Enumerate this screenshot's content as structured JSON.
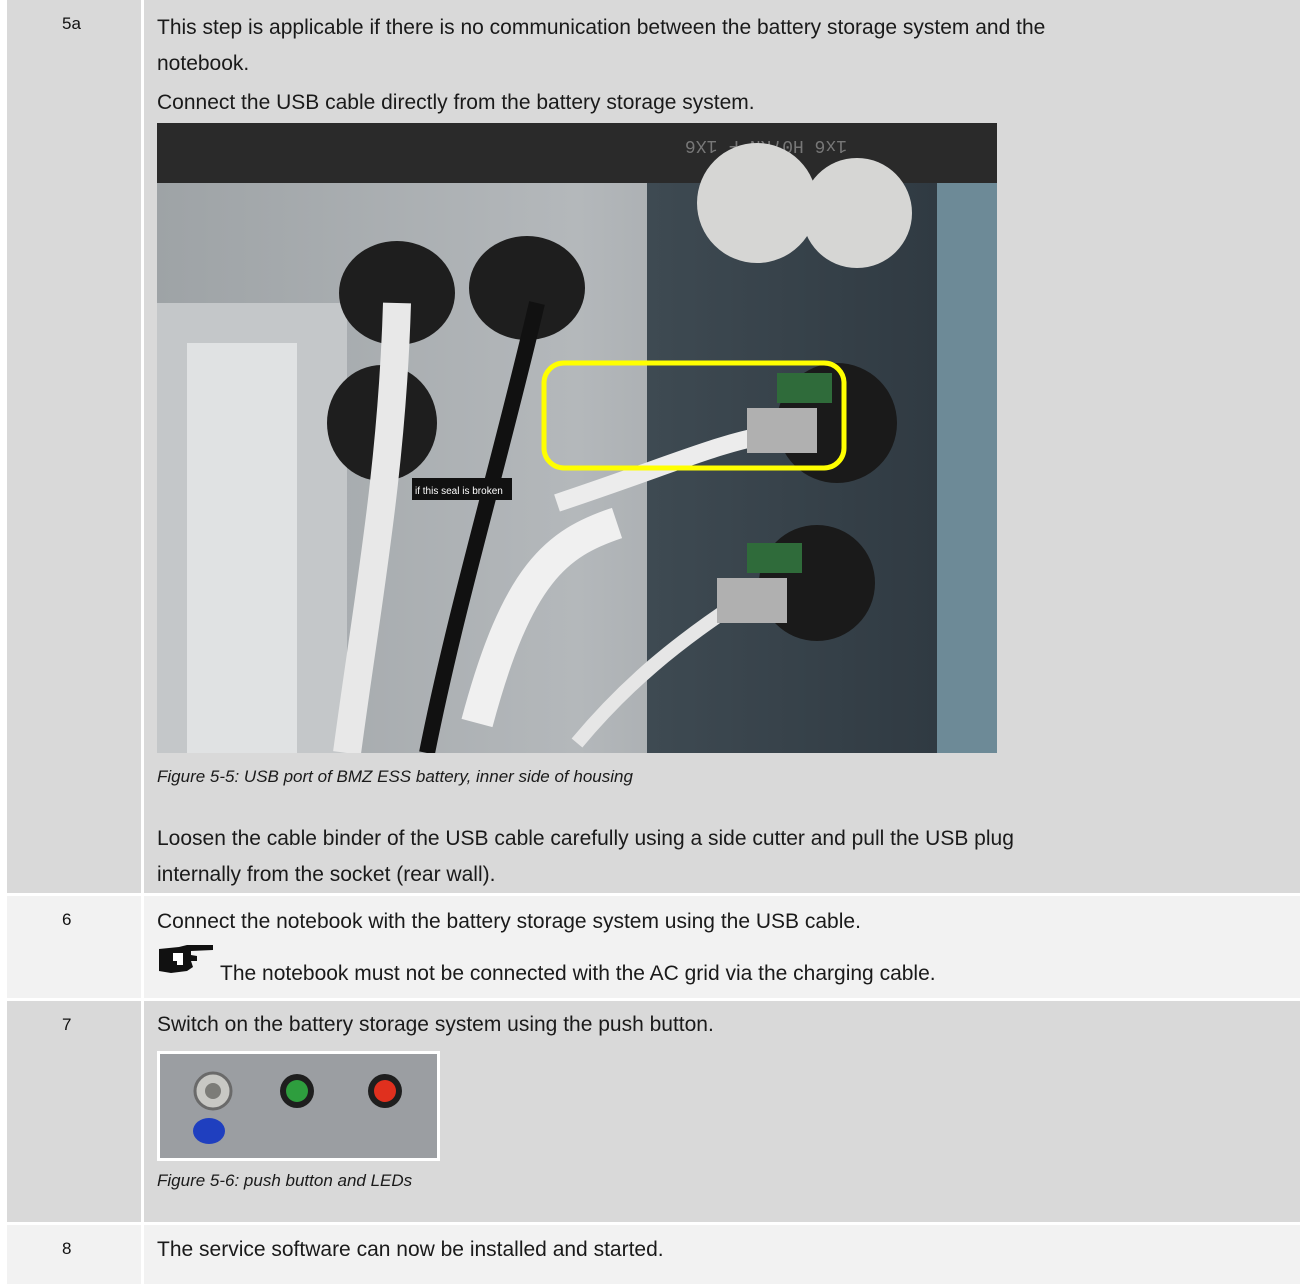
{
  "steps": [
    {
      "number": "5a",
      "lines": [
        "This step is applicable if there is no communication between the battery storage system and the",
        "notebook.",
        "Connect the USB cable directly from the battery storage system."
      ],
      "figure_caption": "Figure 5-5: USB port of BMZ ESS battery, inner side of housing",
      "after_lines": [
        "Loosen the cable binder of the USB cable carefully using a side cutter and pull the USB plug",
        "internally from the socket (rear wall)."
      ],
      "photo_cable_text": "1x6 H07RN-F 1X6",
      "photo_seal_text": "if this seal is broken"
    },
    {
      "number": "6",
      "lines": [
        "Connect the notebook with the battery storage system using the USB cable."
      ],
      "note": "The notebook must not be connected with the AC grid via the charging cable."
    },
    {
      "number": "7",
      "lines": [
        "Switch on the battery storage system using the push button."
      ],
      "figure_caption": "Figure 5-6: push button and LEDs"
    },
    {
      "number": "8",
      "lines": [
        "The service software can now be installed and started."
      ]
    }
  ],
  "colors": {
    "row_gray": "#d9d9d9",
    "row_light": "#f2f2f2",
    "highlight": "#ffff00"
  }
}
